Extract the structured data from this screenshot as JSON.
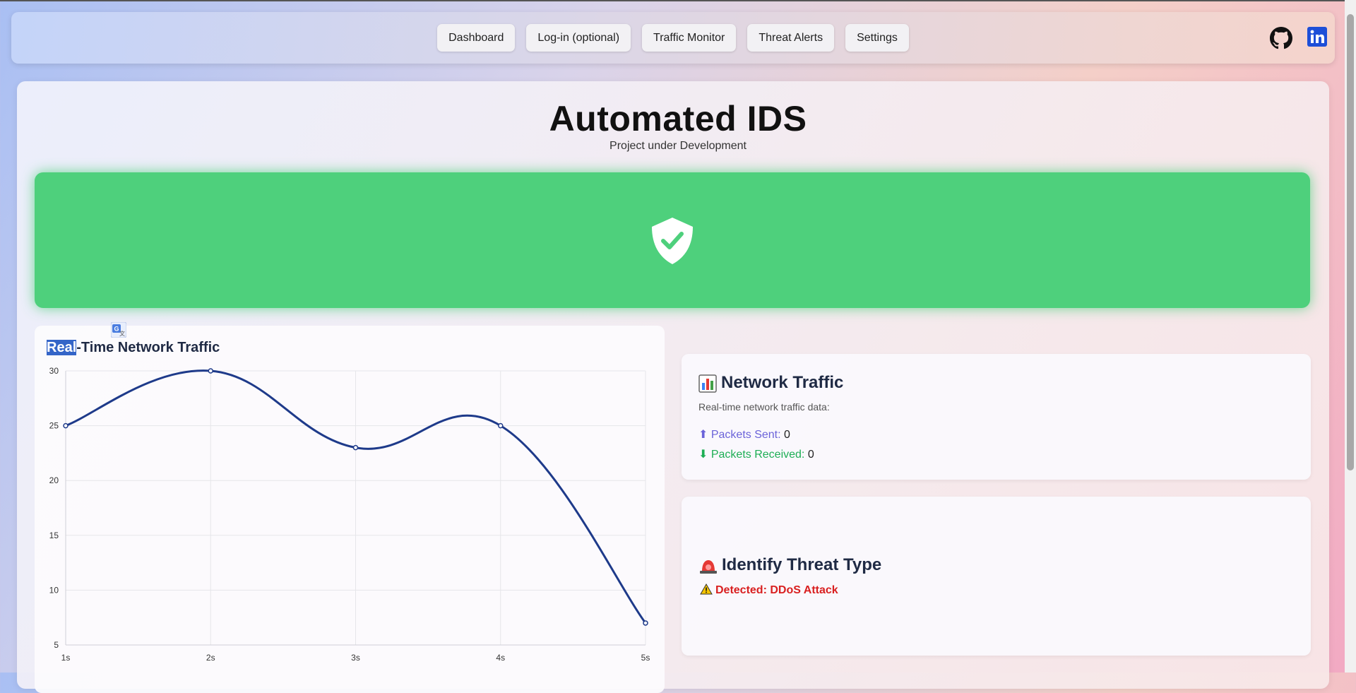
{
  "nav": {
    "items": [
      {
        "label": "Dashboard"
      },
      {
        "label": "Log-in (optional)"
      },
      {
        "label": "Traffic Monitor"
      },
      {
        "label": "Threat Alerts"
      },
      {
        "label": "Settings"
      }
    ],
    "social": [
      "github-icon",
      "linkedin-icon"
    ]
  },
  "header": {
    "title": "Automated IDS",
    "subtitle": "Project under Development"
  },
  "status": {
    "icon": "shield-check-icon",
    "color": "#4ed07c"
  },
  "chart_title": {
    "selected": "Real",
    "rest": "-Time Network Traffic"
  },
  "chart_data": {
    "type": "line",
    "categories": [
      "1s",
      "2s",
      "3s",
      "4s",
      "5s"
    ],
    "series": [
      {
        "values": [
          25,
          30,
          23,
          25,
          7
        ]
      }
    ],
    "yticks": [
      30,
      25,
      20,
      15,
      10,
      5
    ],
    "ylim": [
      5,
      30
    ],
    "grid": true,
    "line_color": "#1e3a8a"
  },
  "network_traffic": {
    "icon": "bar-chart-icon",
    "title": "Network Traffic",
    "description": "Real-time network traffic data:",
    "sent_label": "⬆ Packets Sent:",
    "sent_value": "0",
    "received_label": "⬇ Packets Received:",
    "received_value": "0"
  },
  "threat": {
    "icon": "siren-icon",
    "title": "Identify Threat Type",
    "detected": "Detected: DDoS Attack"
  }
}
